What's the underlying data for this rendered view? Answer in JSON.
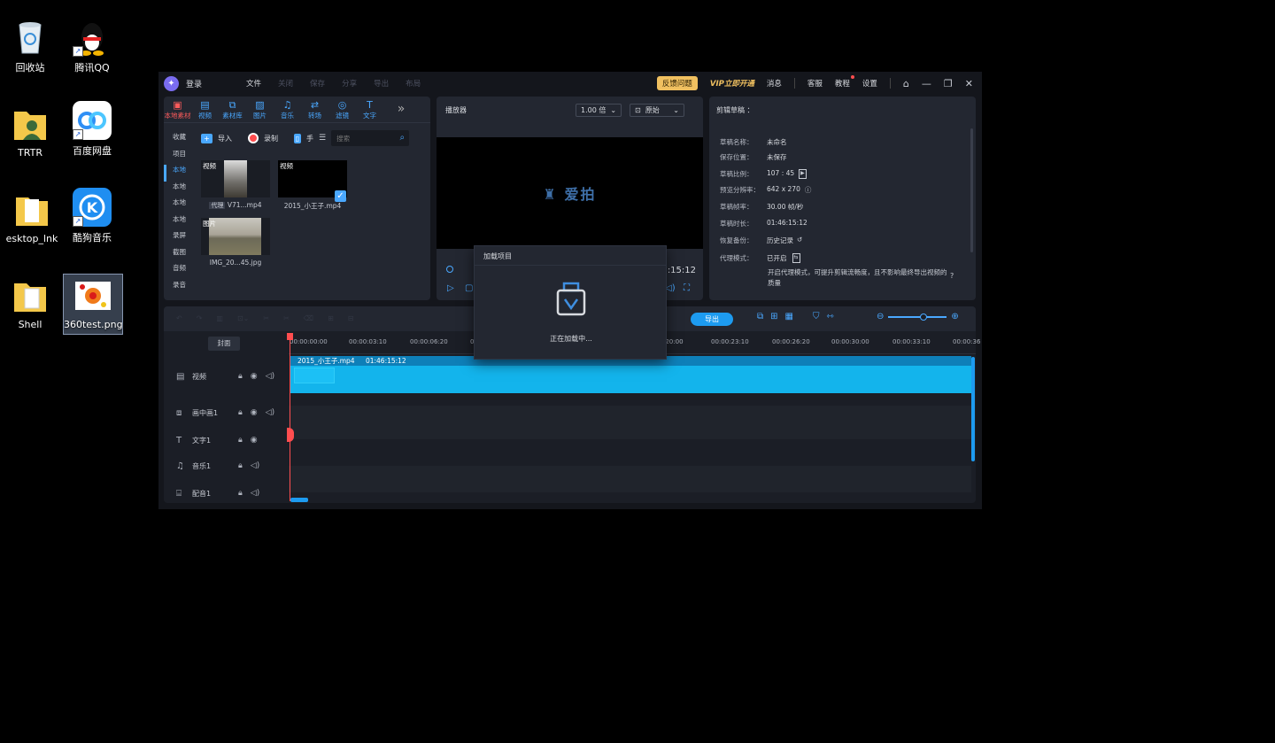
{
  "desktop": {
    "icons": [
      {
        "label": "回收站"
      },
      {
        "label": "腾讯QQ"
      },
      {
        "label": "TRTR"
      },
      {
        "label": "百度网盘"
      },
      {
        "label": "esktop_lnk"
      },
      {
        "label": "酷狗音乐"
      },
      {
        "label": "Shell"
      },
      {
        "label": "360test.png"
      }
    ]
  },
  "app": {
    "title": "登录",
    "menu": [
      "文件",
      "关闭",
      "保存",
      "分享",
      "导出",
      "布局"
    ],
    "feedback": "反馈问题",
    "vip": "VIP立即开通",
    "links": [
      "消息",
      "客服",
      "教程",
      "设置"
    ],
    "media": {
      "tabs": [
        "本地素材",
        "视频",
        "素材库",
        "图片",
        "音乐",
        "转场",
        "滤镜",
        "文字"
      ],
      "side": [
        "收藏",
        "项目",
        "本地",
        "本地",
        "本地",
        "本地",
        "录屏",
        "截图",
        "音频",
        "录音"
      ],
      "import": "导入",
      "record": "录制",
      "hand": "手",
      "search_placeholder": "搜索",
      "clips": [
        {
          "tag": "视频",
          "proxy": "代理",
          "name": "V71...mp4"
        },
        {
          "tag": "视频",
          "name": "2015_小王子.mp4"
        },
        {
          "tag": "图片",
          "name": "IMG_20...45.jpg"
        }
      ]
    },
    "player": {
      "title": "播放器",
      "speed": "1.00 倍",
      "ratio": "原始",
      "brand": "爱拍",
      "timecode": ":15:12"
    },
    "props": {
      "title": "剪辑草稿 ：",
      "rows": [
        {
          "k": "草稿名称：",
          "v": "未命名"
        },
        {
          "k": "保存位置：",
          "v": "未保存"
        },
        {
          "k": "草稿比例：",
          "v": "107 : 45"
        },
        {
          "k": "预览分辨率：",
          "v": "642 x 270"
        },
        {
          "k": "草稿帧率：",
          "v": "30.00 帧/秒"
        },
        {
          "k": "草稿时长：",
          "v": "01:46:15:12"
        },
        {
          "k": "恢复备份：",
          "v": "历史记录"
        },
        {
          "k": "代理模式：",
          "v": "已开启"
        }
      ],
      "note": "开启代理模式，可提升剪辑流畅度，且不影响最终导出视频的质量"
    },
    "timeline": {
      "export": "导出",
      "cover": "封面",
      "ticks": [
        "00:00:00:00",
        "00:00:03:10",
        "00:00:06:20",
        "0",
        ":20:00",
        "00:00:23:10",
        "00:00:26:20",
        "00:00:30:00",
        "00:00:33:10",
        "00:00:36"
      ],
      "tracks": [
        {
          "name": "视频"
        },
        {
          "name": "画中画1"
        },
        {
          "name": "文字1"
        },
        {
          "name": "音乐1"
        },
        {
          "name": "配音1"
        }
      ],
      "clip_name": "2015_小王子.mp4",
      "clip_duration": "01:46:15:12"
    },
    "modal": {
      "title": "加载项目",
      "text": "正在加载中..."
    }
  }
}
